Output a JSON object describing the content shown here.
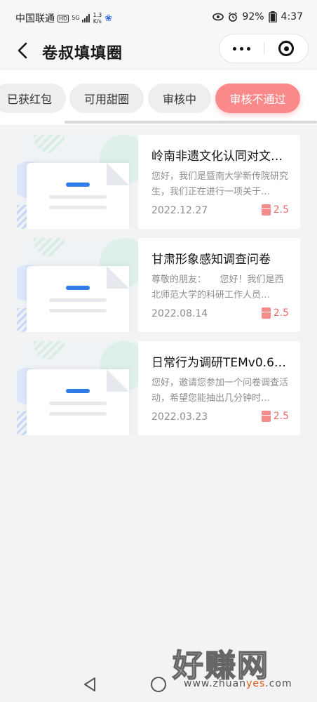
{
  "status_bar": {
    "carrier": "中国联通",
    "hd": "HD",
    "network": "5G",
    "net_speed_value": "1.3",
    "net_speed_unit": "K/s",
    "battery": "92%",
    "time": "4:37"
  },
  "nav": {
    "title": "卷叔填填圈"
  },
  "tabs": [
    {
      "label": "已获红包",
      "active": false
    },
    {
      "label": "可用甜圈",
      "active": false
    },
    {
      "label": "审核中",
      "active": false
    },
    {
      "label": "审核不通过",
      "active": true
    }
  ],
  "surveys": [
    {
      "title": "岭南非遗文化认同对文…",
      "description": "您好，我们是暨南大学新传院研究生，我们正在进行一项关于…",
      "date": "2022.12.27",
      "reward": "2.5"
    },
    {
      "title": "甘肃形象感知调查问卷",
      "description": "尊敬的朋友：　　您好！我们是西北师范大学的科研工作人员…",
      "date": "2022.08.14",
      "reward": "2.5"
    },
    {
      "title": "日常行为调研TEMv0.6…",
      "description": "您好，邀请您参加一个问卷调查活动，希望您能抽出几分钟时…",
      "date": "2022.03.23",
      "reward": "2.5"
    }
  ],
  "watermark": {
    "text": "好赚网",
    "url_prefix": "www.zhuan",
    "url_highlight": "yes",
    "url_suffix": ".com"
  },
  "colors": {
    "accent": "#fa8a8a",
    "reward": "#f06a6a",
    "thumb_bar": "#2f7be8"
  }
}
